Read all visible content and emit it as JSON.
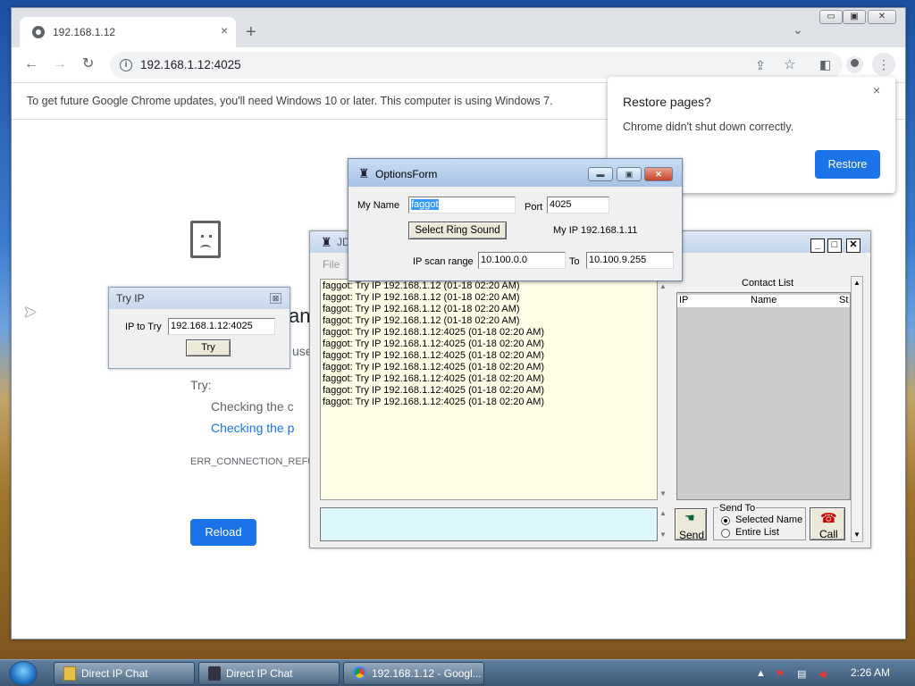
{
  "chrome": {
    "tab_title": "192.168.1.12",
    "tab_close": "×",
    "new_tab": "+",
    "tab_dropdown": "⌄",
    "win_min": "▭",
    "win_max": "▣",
    "win_close": "✕",
    "address": "192.168.1.12:4025",
    "info_icon": "i",
    "infobar": "To get future Google Chrome updates, you'll need Windows 10 or later. This computer is using Windows 7."
  },
  "error_page": {
    "heading": "an",
    "use_text": "use",
    "try_label": "Try:",
    "items": [
      "Checking the c",
      "Checking the p"
    ],
    "code": "ERR_CONNECTION_REFU",
    "reload": "Reload"
  },
  "restore": {
    "title": "Restore pages?",
    "message": "Chrome didn't shut down correctly.",
    "close": "×",
    "button": "Restore"
  },
  "try_ip": {
    "title": "Try IP",
    "close": "⊠",
    "label": "IP to Try",
    "value": "192.168.1.12:4025",
    "button": "Try"
  },
  "options": {
    "title": "OptionsForm",
    "my_name_label": "My Name",
    "my_name_value": "faggot",
    "port_label": "Port",
    "port_value": "4025",
    "ring_button": "Select Ring Sound",
    "my_ip": "My IP 192.168.1.11",
    "scan_label": "IP scan range",
    "scan_from": "10.100.0.0",
    "to_label": "To",
    "scan_to": "10.100.9.255"
  },
  "jdip": {
    "title": "JD",
    "menu_file": "File",
    "log": [
      "faggot: Try IP 192.168.1.12 (01-18 02:20 AM)",
      "faggot: Try IP 192.168.1.12 (01-18 02:20 AM)",
      "faggot: Try IP 192.168.1.12 (01-18 02:20 AM)",
      "faggot: Try IP 192.168.1.12 (01-18 02:20 AM)",
      "faggot: Try IP 192.168.1.12:4025 (01-18 02:20 AM)",
      "faggot: Try IP 192.168.1.12:4025 (01-18 02:20 AM)",
      "faggot: Try IP 192.168.1.12:4025 (01-18 02:20 AM)",
      "faggot: Try IP 192.168.1.12:4025 (01-18 02:20 AM)",
      "faggot: Try IP 192.168.1.12:4025 (01-18 02:20 AM)",
      "faggot: Try IP 192.168.1.12:4025 (01-18 02:20 AM)",
      "faggot: Try IP 192.168.1.12:4025 (01-18 02:20 AM)"
    ],
    "contact_title": "Contact List",
    "col_ip": "IP",
    "col_name": "Name",
    "col_st": "St",
    "send": "Send",
    "send_to_legend": "Send To",
    "opt_selected": "Selected Name",
    "opt_entire": "Entire List",
    "call": "Call"
  },
  "taskbar": {
    "items": [
      "Direct IP Chat",
      "Direct IP Chat",
      "192.168.1.12 - Googl..."
    ],
    "clock": "2:26 AM",
    "tray_arrow": "▲"
  }
}
